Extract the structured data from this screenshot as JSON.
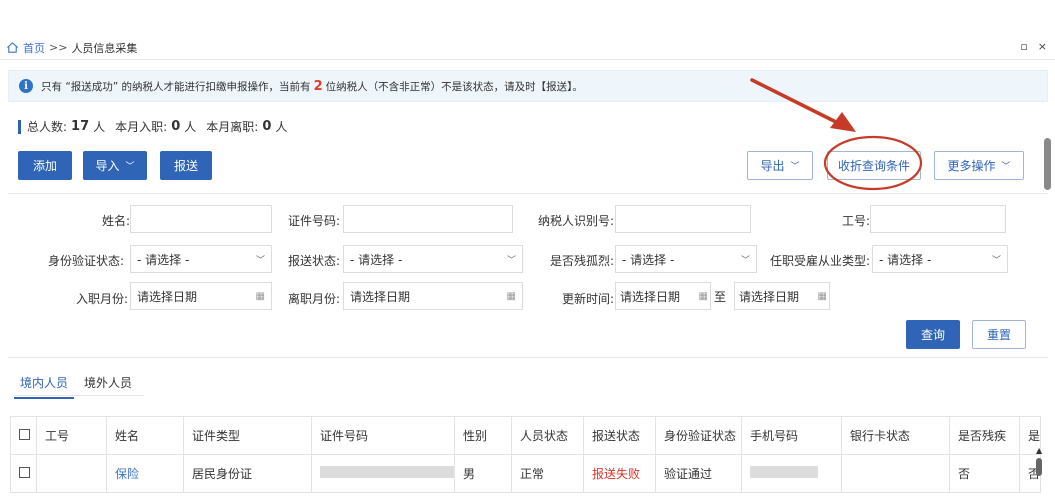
{
  "breadcrumb": {
    "home": "首页",
    "sep": ">>",
    "current": "人员信息采集"
  },
  "window": {
    "restore": "▫",
    "close": "×"
  },
  "notice": {
    "info": "i",
    "pre": "只有 “报送成功” 的纳税人才能进行扣缴申报操作，当前有",
    "count": "2",
    "post": "位纳税人（不含非正常）不是该状态，请及时【报送】。"
  },
  "stats": {
    "total_label": "总人数:",
    "total_value": "17",
    "total_unit": "人",
    "join_label": "本月入职:",
    "join_value": "0",
    "join_unit": "人",
    "leave_label": "本月离职:",
    "leave_value": "0",
    "leave_unit": "人"
  },
  "toolbar": {
    "add": "添加",
    "import": "导入",
    "submit": "报送",
    "export": "导出",
    "collapse": "收折查询条件",
    "more": "更多操作"
  },
  "filters": {
    "name_label": "姓名:",
    "idno_label": "证件号码:",
    "taxid_label": "纳税人识别号:",
    "empno_label": "工号:",
    "verify_label": "身份验证状态:",
    "verify_value": "- 请选择 -",
    "report_label": "报送状态:",
    "report_value": "- 请选择 -",
    "disabled_label": "是否残孤烈:",
    "disabled_value": "- 请选择 -",
    "employ_label": "任职受雇从业类型:",
    "employ_value": "- 请选择 -",
    "join_month_label": "入职月份:",
    "join_month_value": "请选择日期",
    "leave_month_label": "离职月份:",
    "leave_month_value": "请选择日期",
    "update_label": "更新时间:",
    "update_from": "请选择日期",
    "to": "至",
    "update_to": "请选择日期",
    "query": "查询",
    "reset": "重置"
  },
  "tabs": [
    {
      "label": "境内人员"
    },
    {
      "label": "境外人员"
    }
  ],
  "table": {
    "headers": [
      "工号",
      "姓名",
      "证件类型",
      "证件号码",
      "性别",
      "人员状态",
      "报送状态",
      "身份验证状态",
      "手机号码",
      "银行卡状态",
      "是否残疾",
      "是"
    ],
    "rows": [
      {
        "empno": "",
        "name": "保险",
        "idtype": "居民身份证",
        "idno": "",
        "gender": "男",
        "status": "正常",
        "report": "报送失败",
        "verify": "验证通过",
        "phone": "",
        "bank": "",
        "disabled": "否",
        "extra": "否"
      }
    ]
  },
  "colors": {
    "primary": "#2f64b6",
    "danger": "#d9352b",
    "notice_bg": "#eef6fc",
    "annotation": "#c83a28"
  }
}
